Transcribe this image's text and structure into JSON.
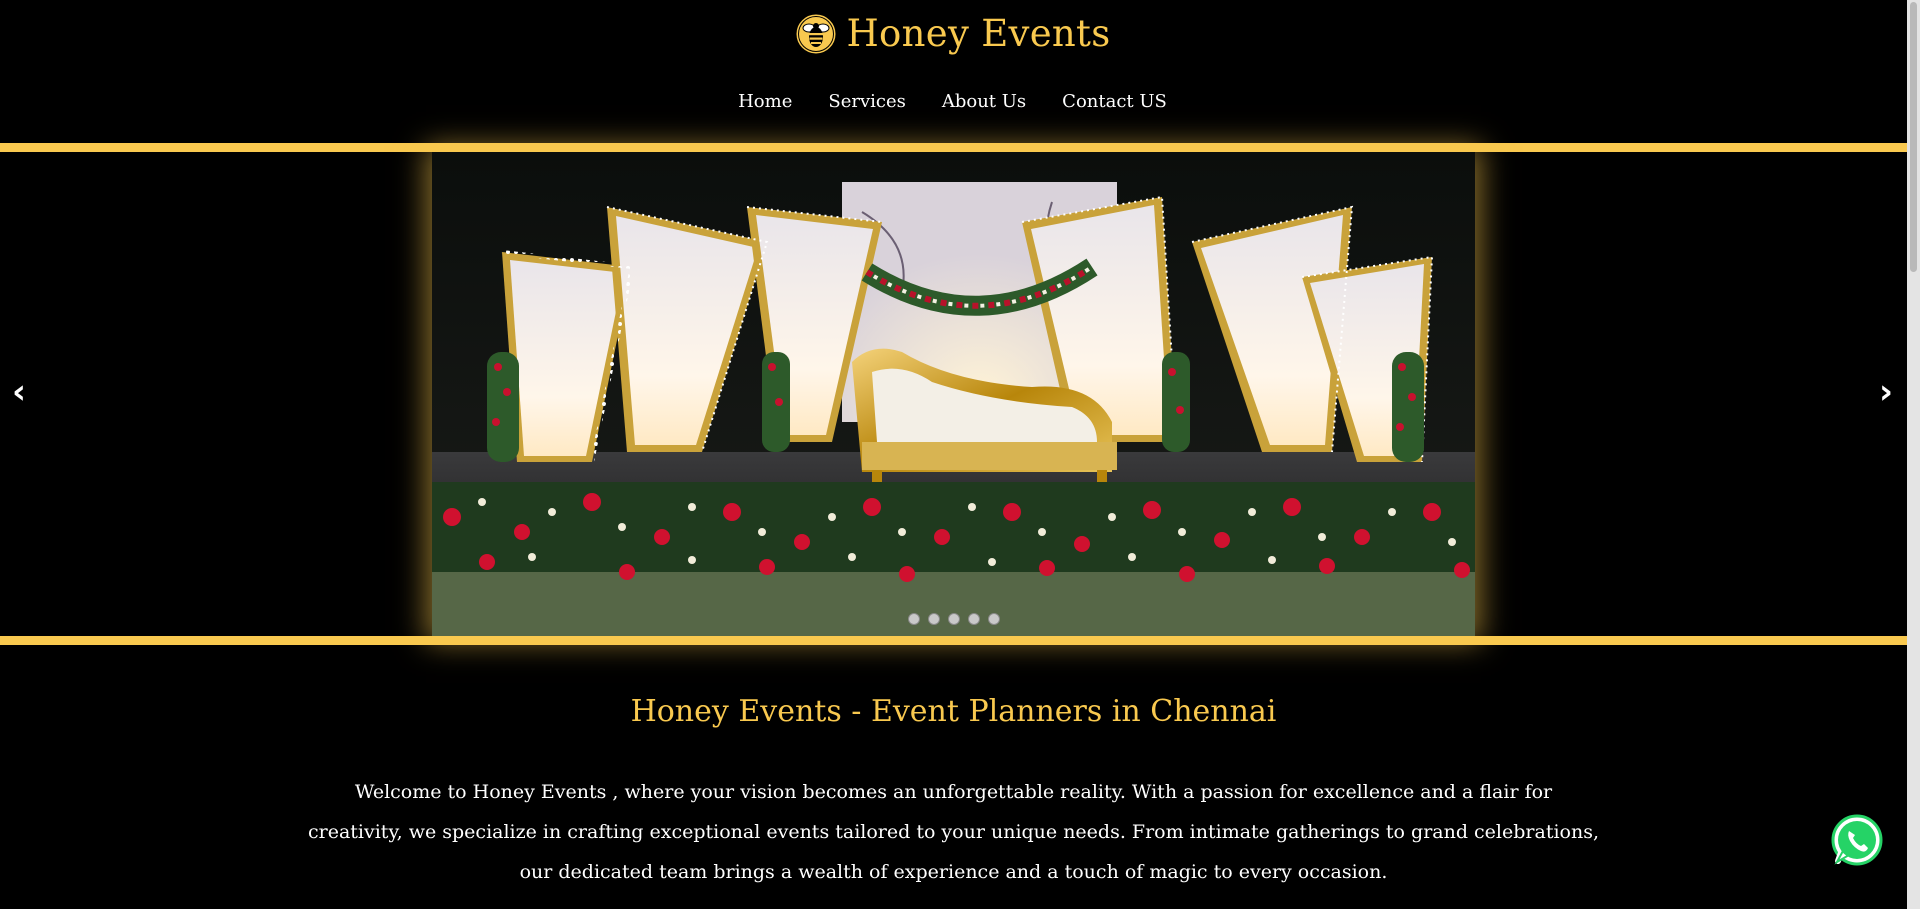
{
  "brand": {
    "name": "Honey Events",
    "logo_icon": "bee-icon",
    "accent_color": "#f9c94f"
  },
  "nav": {
    "items": [
      "Home",
      "Services",
      "About Us",
      "Contact US"
    ]
  },
  "slider": {
    "prev_label": "‹",
    "next_label": "›",
    "slide_count": 5,
    "active_slide": 1,
    "frame_glow_color": "#f9c94f"
  },
  "main": {
    "title": "Honey Events - Event Planners in Chennai",
    "intro": "Welcome to Honey Events , where your vision becomes an unforgettable reality. With a passion for excellence and a flair for creativity, we specialize in crafting exceptional events tailored to your unique needs. From intimate gatherings to grand celebrations, our dedicated team brings a wealth of experience and a touch of magic to every occasion."
  },
  "floating": {
    "whatsapp_icon": "whatsapp-icon"
  }
}
